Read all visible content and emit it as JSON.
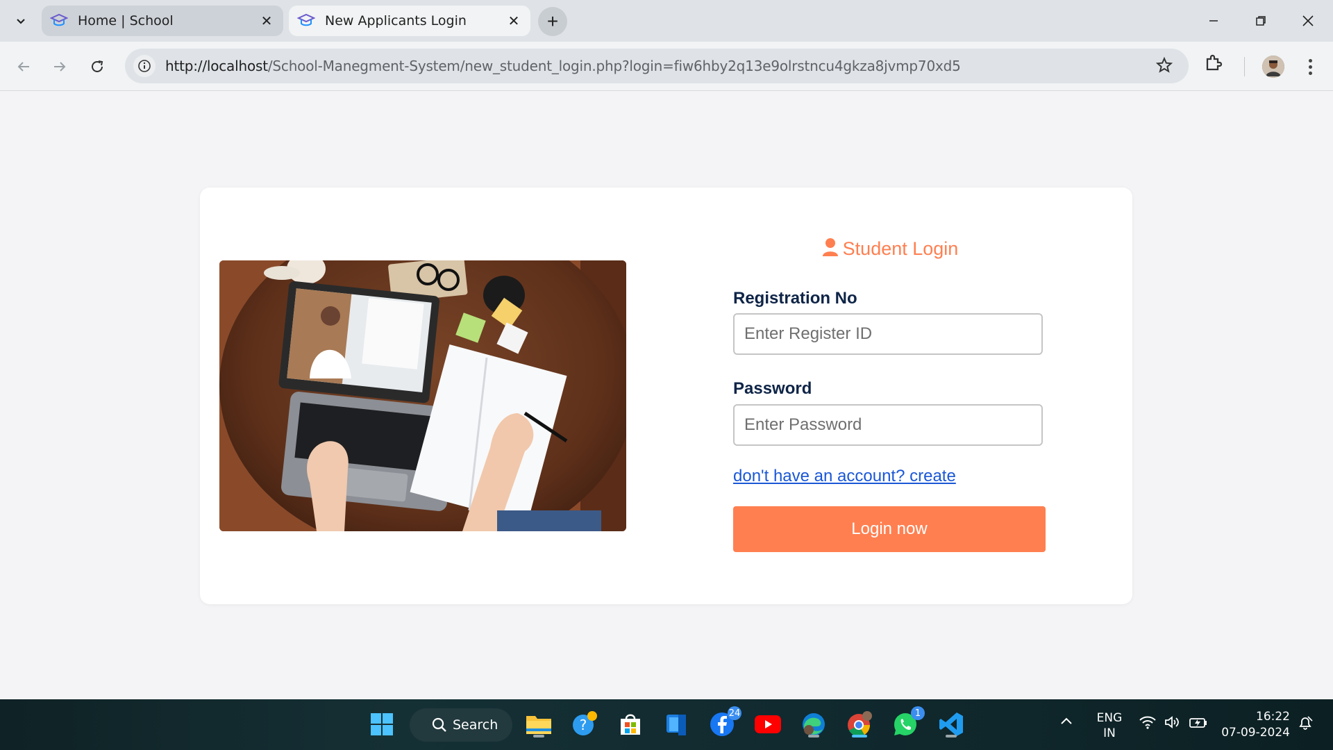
{
  "browser": {
    "tabs": [
      {
        "title": "Home | School",
        "active": false
      },
      {
        "title": "New Applicants Login",
        "active": true
      }
    ],
    "url_host": "http://localhost",
    "url_path": "/School-Manegment-System/new_student_login.php?login=fiw6hby2q13e9olrstncu4gkza8jvmp70xd5"
  },
  "login": {
    "title": "Student Login",
    "registration_label": "Registration No",
    "registration_placeholder": "Enter Register ID",
    "password_label": "Password",
    "password_placeholder": "Enter Password",
    "create_link": "don't have an account? create",
    "submit_label": "Login now",
    "accent_color": "#ff7f50"
  },
  "taskbar": {
    "search_label": "Search",
    "badges": {
      "facebook": "24",
      "whatsapp": "1"
    },
    "language": "ENG",
    "region": "IN",
    "time": "16:22",
    "date": "07-09-2024"
  }
}
